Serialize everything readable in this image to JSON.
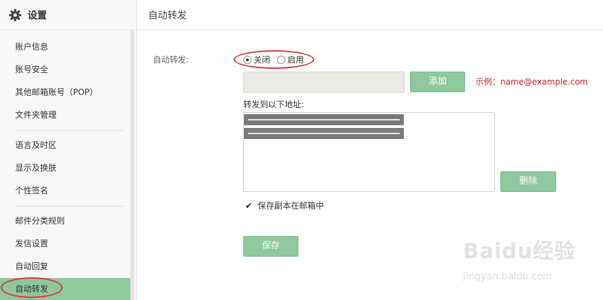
{
  "sidebar": {
    "title": "设置",
    "groups": [
      [
        {
          "label": "账户信息"
        },
        {
          "label": "账号安全"
        },
        {
          "label": "其他邮箱账号（POP）"
        },
        {
          "label": "文件夹管理"
        }
      ],
      [
        {
          "label": "语言及时区"
        },
        {
          "label": "显示及换肤"
        },
        {
          "label": "个性签名"
        }
      ],
      [
        {
          "label": "邮件分类规则"
        },
        {
          "label": "发信设置"
        },
        {
          "label": "自动回复"
        },
        {
          "label": "自动转发"
        }
      ]
    ]
  },
  "main": {
    "title": "自动转发",
    "field_label": "自动转发:",
    "radio_off": "关闭",
    "radio_on": "启用",
    "selected": "关闭",
    "email_input_value": "",
    "add_label": "添加",
    "example": "示例：name@example.com",
    "forward_to_label": "转发到以下地址:",
    "delete_label": "删除",
    "keep_copy_label": "保存副本在邮箱中",
    "keep_copy_checked": true,
    "save_label": "保存"
  },
  "watermark": {
    "text": "Baidu经验",
    "sub": "jingyan.baidu.com"
  },
  "colors": {
    "accent": "#8fc79e",
    "highlight_ring": "#d9383a",
    "example_text": "#cc2222"
  }
}
